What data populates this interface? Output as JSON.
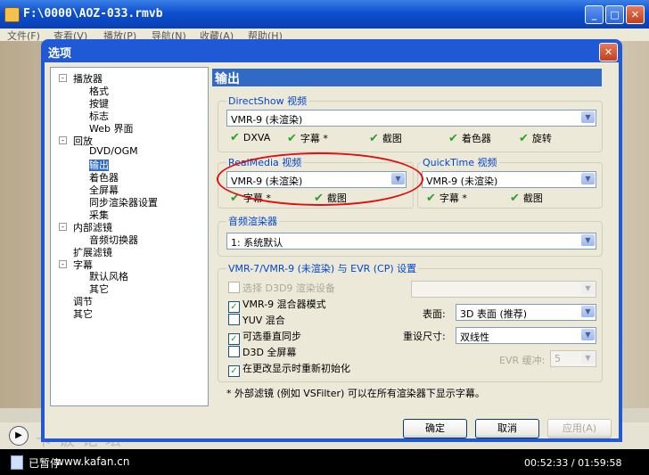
{
  "player": {
    "title": "F:\\0000\\AOZ-033.rmvb",
    "menu": [
      "文件(F)",
      "查看(V)",
      "播放(P)",
      "导航(N)",
      "收藏(A)",
      "帮助(H)"
    ],
    "status": "已暂停",
    "time": "00:52:33 / 01:59:58",
    "watermark": "卡饭论坛",
    "watermark_url": "www.kafan.cn",
    "minimize_icon": "minimize-icon",
    "maximize_icon": "maximize-icon",
    "close_icon": "close-icon"
  },
  "dialog": {
    "title": "选项",
    "tree": [
      {
        "label": "播放器",
        "level": 0,
        "expander": "-"
      },
      {
        "label": "格式",
        "level": 1
      },
      {
        "label": "按键",
        "level": 1
      },
      {
        "label": "标志",
        "level": 1
      },
      {
        "label": "Web 界面",
        "level": 1
      },
      {
        "label": "回放",
        "level": 0,
        "expander": "-"
      },
      {
        "label": "DVD/OGM",
        "level": 1
      },
      {
        "label": "输出",
        "level": 1,
        "selected": true
      },
      {
        "label": "着色器",
        "level": 1
      },
      {
        "label": "全屏幕",
        "level": 1
      },
      {
        "label": "同步渲染器设置",
        "level": 1
      },
      {
        "label": "采集",
        "level": 1
      },
      {
        "label": "内部滤镜",
        "level": 0,
        "expander": "-"
      },
      {
        "label": "音频切换器",
        "level": 1
      },
      {
        "label": "扩展滤镜",
        "level": 0
      },
      {
        "label": "字幕",
        "level": 0,
        "expander": "-"
      },
      {
        "label": "默认风格",
        "level": 1
      },
      {
        "label": "其它",
        "level": 1
      },
      {
        "label": "调节",
        "level": 0
      },
      {
        "label": "其它",
        "level": 0
      }
    ],
    "page_title": "输出",
    "directshow": {
      "label": "DirectShow 视频",
      "value": "VMR-9 (未渲染)",
      "features": [
        "DXVA",
        "字幕 *",
        "截图",
        "着色器",
        "旋转"
      ]
    },
    "realmedia": {
      "label": "RealMedia 视频",
      "value": "VMR-9 (未渲染)",
      "features": [
        "字幕 *",
        "截图"
      ]
    },
    "quicktime": {
      "label": "QuickTime 视频",
      "value": "VMR-9 (未渲染)",
      "features": [
        "字幕 *",
        "截图"
      ]
    },
    "audio": {
      "label": "音频渲染器",
      "value": "1: 系统默认"
    },
    "vmr": {
      "label": "VMR-7/VMR-9 (未渲染) 与 EVR (CP) 设置",
      "d3d9_label": "选择 D3D9 渲染设备",
      "d3d9_checked": false,
      "d3d9_device": "",
      "mix_label": "VMR-9 混合器模式",
      "mix_checked": true,
      "yuv_label": "YUV 混合",
      "yuv_checked": false,
      "vsync_label": "可选垂直同步",
      "vsync_checked": true,
      "d3dfull_label": "D3D 全屏幕",
      "d3dfull_checked": false,
      "reinit_label": "在更改显示时重新初始化",
      "reinit_checked": true,
      "surface_label": "表面:",
      "surface_value": "3D 表面 (推荐)",
      "resize_label": "重设尺寸:",
      "resize_value": "双线性",
      "evr_label": "EVR 缓冲:",
      "evr_value": "5"
    },
    "footnote": "* 外部滤镜 (例如 VSFilter) 可以在所有渲染器下显示字幕。",
    "ok": "确定",
    "cancel": "取消",
    "apply": "应用(A)"
  },
  "colors": {
    "selection": "#316ac5",
    "title_bar": "#0d4fcf",
    "annotation": "#e01010",
    "check": "#2aa12a"
  }
}
